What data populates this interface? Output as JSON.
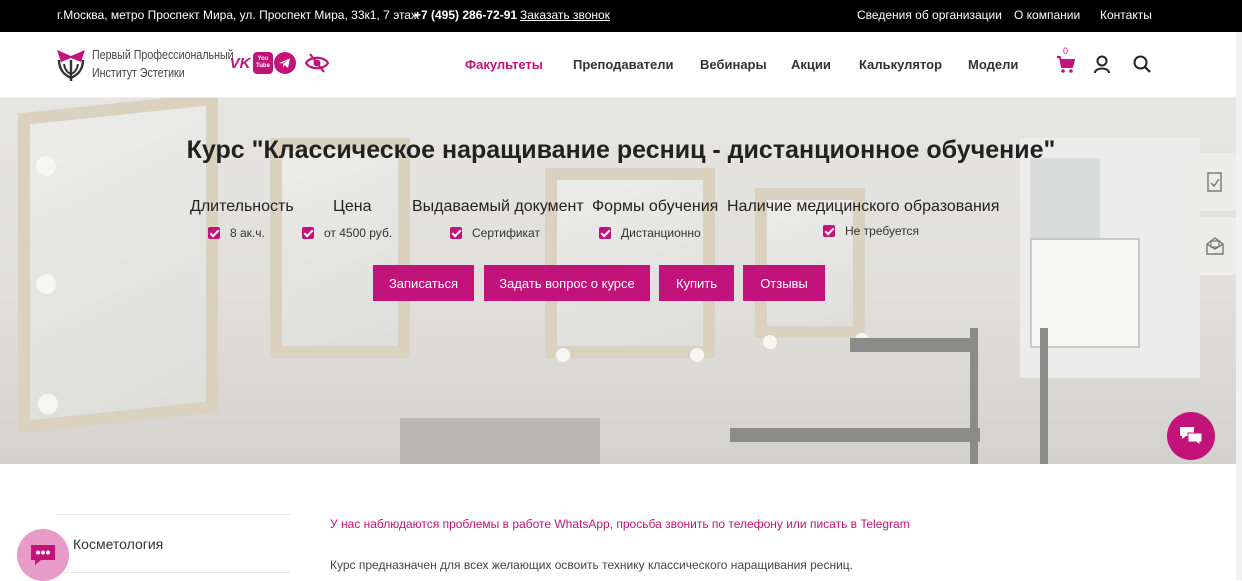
{
  "topbar": {
    "address": "г.Москва, метро Проспект Мира, ул. Проспект Мира, 33к1, 7 этаж",
    "phone": "+7 (495) 286-72-91",
    "callback": "Заказать звонок",
    "links": [
      "Сведения об организации",
      "О компании",
      "Контакты"
    ]
  },
  "header": {
    "logo_line1": "Первый Профессиональный",
    "logo_line2": "Институт Эстетики",
    "social": [
      "vk-icon",
      "youtube-icon",
      "telegram-icon",
      "eye-off-icon"
    ],
    "social_text": {
      "vk": "VK",
      "youtube": "You Tube"
    },
    "nav": [
      "Факультеты",
      "Преподаватели",
      "Вебинары",
      "Акции",
      "Калькулятор",
      "Модели"
    ],
    "cart_count": "0",
    "icons": [
      "cart-icon",
      "user-icon",
      "search-icon"
    ]
  },
  "hero": {
    "title": "Курс \"Классическое наращивание ресниц - дистанционное обучение\"",
    "info": [
      {
        "heading": "Длительность",
        "value": "8 ак.ч."
      },
      {
        "heading": "Цена",
        "value": "от 4500 руб."
      },
      {
        "heading": "Выдаваемый документ",
        "value": "Сертификат"
      },
      {
        "heading": "Формы обучения",
        "value": "Дистанционно"
      },
      {
        "heading": "Наличие медицинского образования",
        "value": "Не требуется"
      }
    ],
    "buttons": [
      "Записаться",
      "Задать вопрос о курсе",
      "Купить",
      "Отзывы"
    ]
  },
  "side_tabs": [
    "document-check-icon",
    "mail-open-icon"
  ],
  "content": {
    "category": "Косметология",
    "notice": "У нас наблюдаются проблемы в работе WhatsApp, просьба звонить по телефону или писать в Telegram",
    "description": "Курс предназначен для всех желающих освоить технику классического наращивания ресниц."
  },
  "colors": {
    "accent": "#c2137b",
    "topbar": "#000000"
  }
}
